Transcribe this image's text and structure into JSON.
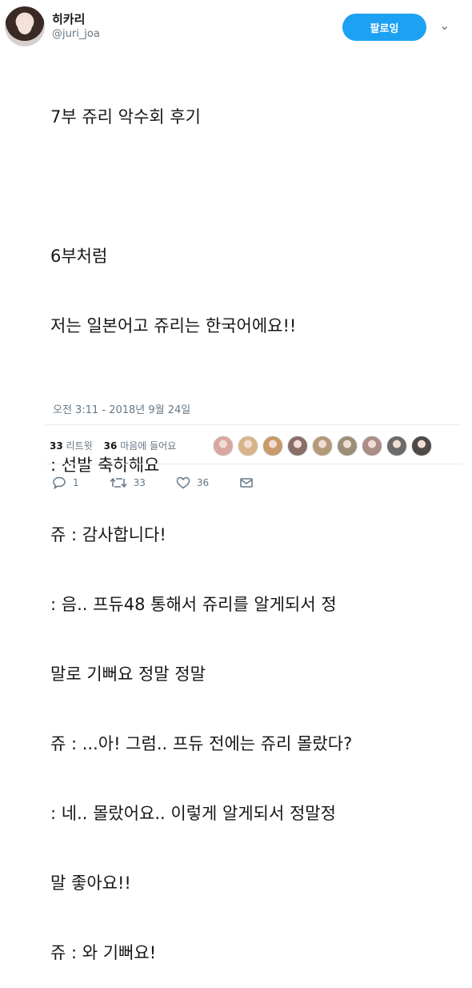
{
  "user": {
    "name": "히카리",
    "handle": "@juri_joa",
    "follow_label": "팔로잉"
  },
  "tweet": {
    "lines": [
      "7부 쥬리 악수회 후기",
      "",
      "6부처럼",
      "저는 일본어고 쥬리는 한국어에요!!",
      "",
      ": 선발 축하해요",
      "쥬 : 감사합니다!",
      ": 음.. 프듀48 통해서 쥬리를 알게되서 정",
      "말로 기뻐요 정말 정말",
      "쥬 : ...아! 그럼.. 프듀 전에는 쥬리 몰랐다?",
      ": 네.. 몰랐어요.. 이렇게 알게되서 정말정",
      "말 좋아요!!",
      "쥬 : 와 기뻐요!"
    ],
    "timestamp": "오전 3:11 - 2018년 9월 24일"
  },
  "stats": {
    "retweets_count": "33",
    "retweets_label": "리트윗",
    "likes_count": "36",
    "likes_label": "마음에 들어요"
  },
  "likers": [
    {
      "color": "#d9a7a0"
    },
    {
      "color": "#d8b48a"
    },
    {
      "color": "#c99a6b"
    },
    {
      "color": "#8a6f66"
    },
    {
      "color": "#b49a7c"
    },
    {
      "color": "#9c8f7a"
    },
    {
      "color": "#a98d86"
    },
    {
      "color": "#6e6a68"
    },
    {
      "color": "#4e4a48"
    }
  ],
  "actions": {
    "reply_count": "1",
    "retweet_count": "33",
    "like_count": "36"
  },
  "colors": {
    "accent": "#1da1f2",
    "text": "#14171a",
    "muted": "#657786",
    "divider": "#e6ecf0"
  }
}
